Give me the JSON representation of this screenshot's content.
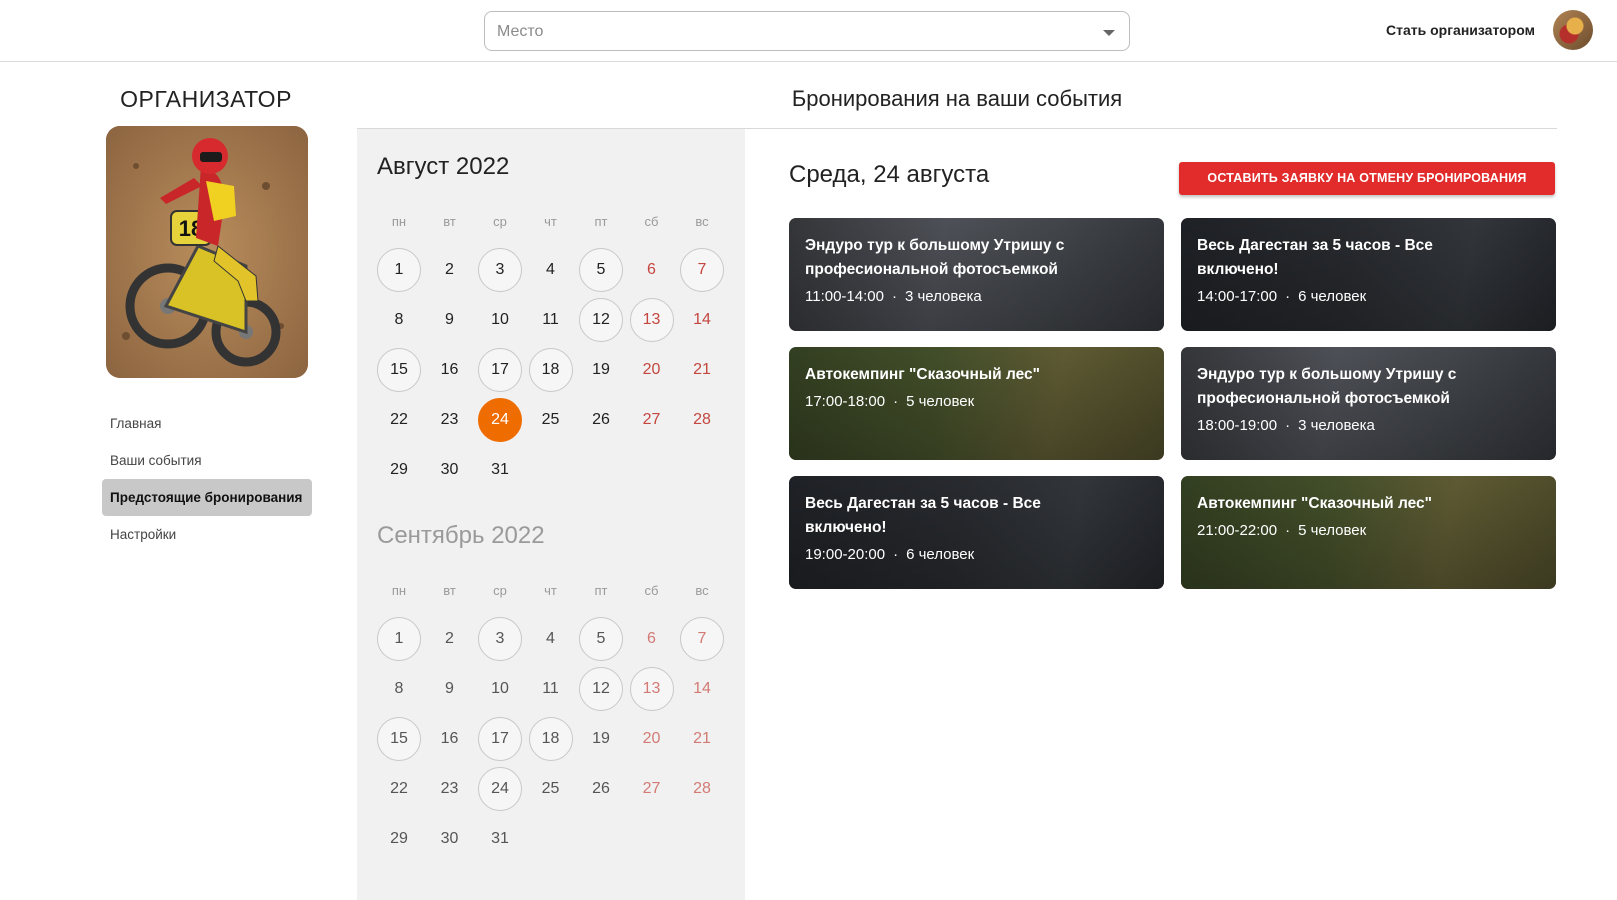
{
  "header": {
    "place_placeholder": "Место",
    "become_organizer": "Стать организатором"
  },
  "sidebar": {
    "title": "ОРГАНИЗАТОР",
    "nav": [
      {
        "label": "Главная",
        "active": false
      },
      {
        "label": "Ваши события",
        "active": false
      },
      {
        "label": "Предстоящие бронирования",
        "active": true
      },
      {
        "label": "Настройки",
        "active": false
      }
    ]
  },
  "main": {
    "title": "Бронирования на ваши события",
    "date_heading": "Среда, 24 августа",
    "cancel_button": "ОСТАВИТЬ ЗАЯВКУ НА ОТМЕНУ БРОНИРОВАНИЯ"
  },
  "calendar": {
    "weekdays": [
      "пн",
      "вт",
      "ср",
      "чт",
      "пт",
      "сб",
      "вс"
    ],
    "months": [
      {
        "title": "Август 2022",
        "dim": false,
        "start_weekday": 0,
        "days_count": 31,
        "available": [
          1,
          3,
          5,
          7,
          12,
          13,
          15,
          17,
          18,
          24
        ],
        "selected": 24
      },
      {
        "title": "Сентябрь 2022",
        "dim": true,
        "start_weekday": 0,
        "days_count": 31,
        "available": [
          1,
          3,
          5,
          7,
          12,
          13,
          15,
          17,
          18,
          24
        ],
        "selected": null
      }
    ]
  },
  "bookings": [
    {
      "title": "Эндуро тур к большому Утришу с професиональной фотосъемкой",
      "time": "11:00-14:00",
      "people": "3 человека",
      "theme": "enduro"
    },
    {
      "title": "Весь Дагестан за 5 часов - Все включено!",
      "time": "14:00-17:00",
      "people": "6 человек",
      "theme": "dag"
    },
    {
      "title": "Автокемпинг \"Сказочный лес\"",
      "time": "17:00-18:00",
      "people": "5 человек",
      "theme": "camp"
    },
    {
      "title": "Эндуро тур к большому Утришу с професиональной фотосъемкой",
      "time": "18:00-19:00",
      "people": "3 человека",
      "theme": "enduro"
    },
    {
      "title": "Весь Дагестан за 5 часов - Все включено!",
      "time": "19:00-20:00",
      "people": "6 человек",
      "theme": "dag"
    },
    {
      "title": "Автокемпинг \"Сказочный лес\"",
      "time": "21:00-22:00",
      "people": "5 человек",
      "theme": "camp"
    }
  ],
  "colors": {
    "accent_selected": "#ef6c00",
    "cancel_button": "#e22c2c",
    "weekend": "#c4463f"
  }
}
